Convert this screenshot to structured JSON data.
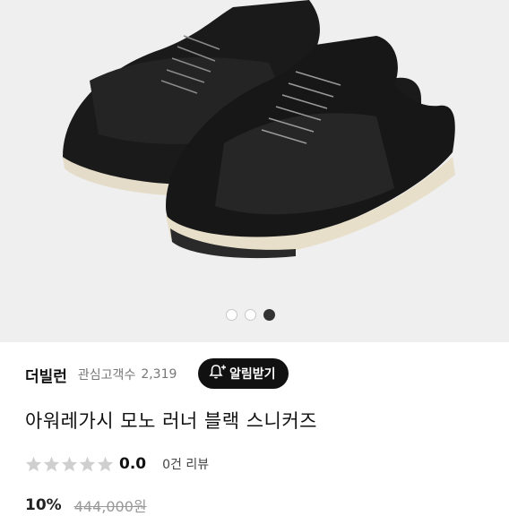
{
  "gallery": {
    "image": "black-mesh-suede-sneakers-photo",
    "dots": [
      {
        "active": false
      },
      {
        "active": false
      },
      {
        "active": true
      }
    ]
  },
  "brand": {
    "name": "더빌런",
    "interest_label": "관심고객수",
    "interest_count": "2,319",
    "alert_button": "알림받기",
    "alert_icon": "bell-plus-icon"
  },
  "product": {
    "title": "아워레가시 모노 러너 블랙 스니커즈"
  },
  "rating": {
    "stars_filled": 0,
    "stars_total": 5,
    "value": "0.0",
    "review_count": "0건 리뷰"
  },
  "price": {
    "discount": "10%",
    "original": "444,000원"
  },
  "colors": {
    "button_bg": "#111111",
    "star_empty": "#cfcfcf",
    "dot_active": "#333333"
  }
}
